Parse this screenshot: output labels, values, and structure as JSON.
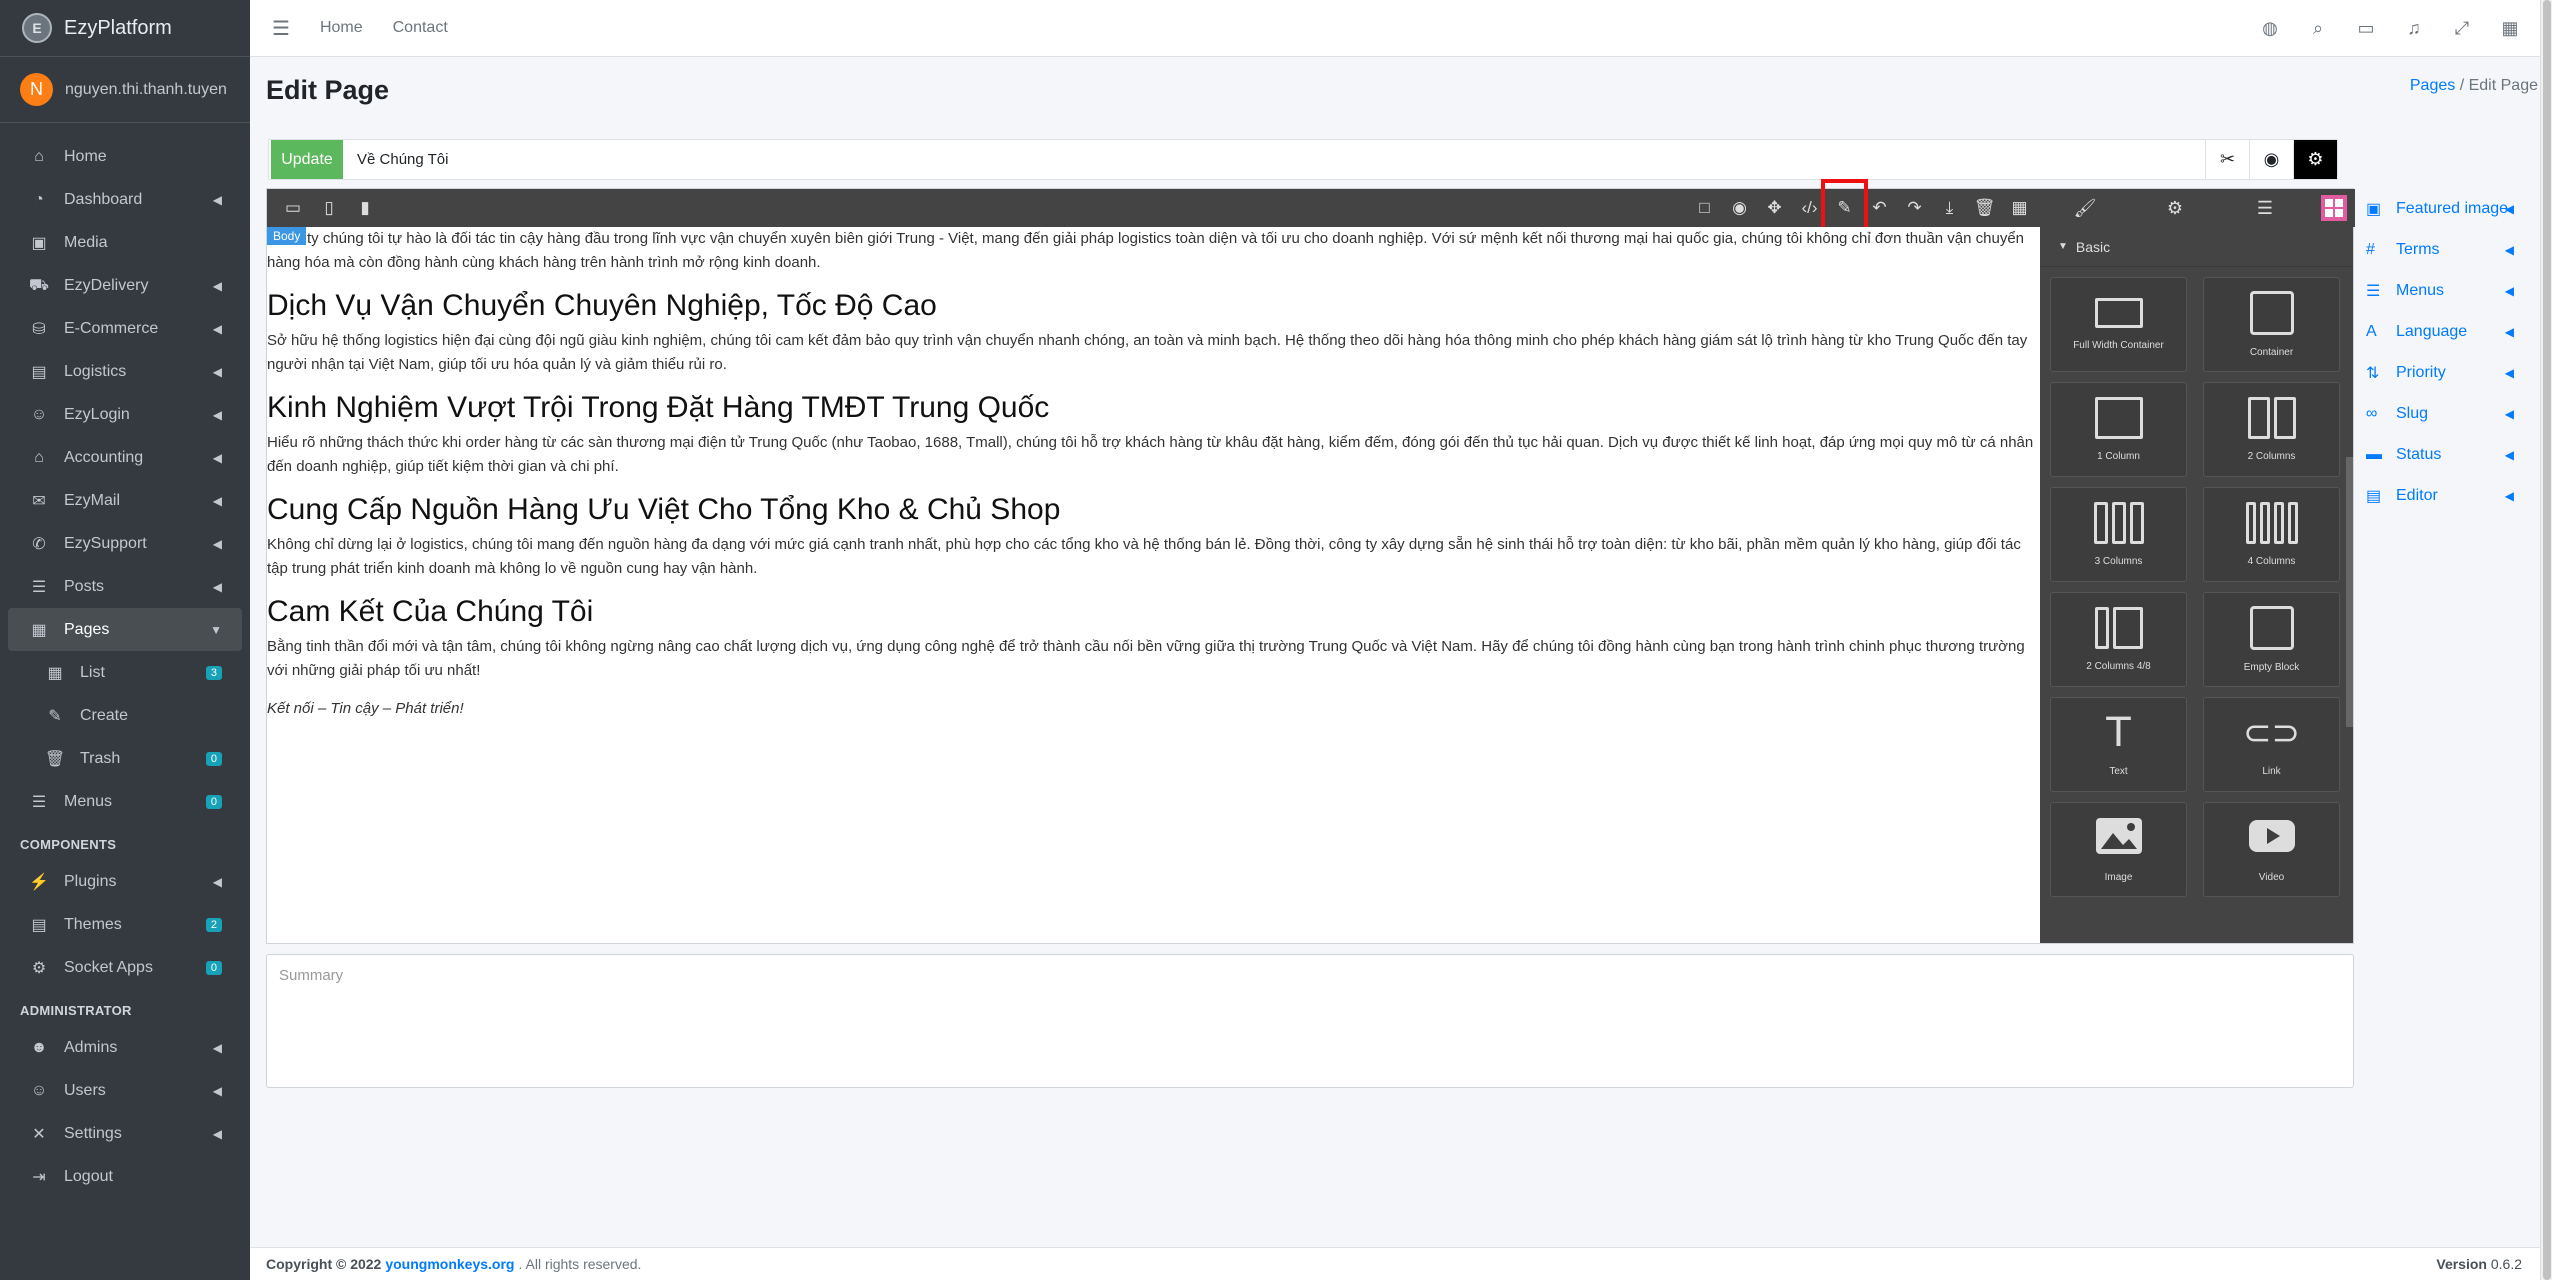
{
  "brand": {
    "logo_glyph": "E",
    "name": "EzyPlatform"
  },
  "user": {
    "initial": "N",
    "name": "nguyen.thi.thanh.tuyen",
    "avatar_color": "#fd7e14"
  },
  "sidebar": {
    "items": [
      {
        "label": "Home",
        "icon": "home-icon",
        "glyph": "⌂"
      },
      {
        "label": "Dashboard",
        "icon": "dashboard-icon",
        "glyph": "◔",
        "chevron": true
      },
      {
        "label": "Media",
        "icon": "media-icon",
        "glyph": "▣"
      },
      {
        "label": "EzyDelivery",
        "icon": "truck-icon",
        "glyph": "⛟",
        "chevron": true
      },
      {
        "label": "E-Commerce",
        "icon": "cart-icon",
        "glyph": "⛁",
        "chevron": true
      },
      {
        "label": "Logistics",
        "icon": "clipboard-icon",
        "glyph": "▤",
        "chevron": true
      },
      {
        "label": "EzyLogin",
        "icon": "user-icon",
        "glyph": "☺",
        "chevron": true
      },
      {
        "label": "Accounting",
        "icon": "bank-icon",
        "glyph": "⌂",
        "chevron": true
      },
      {
        "label": "EzyMail",
        "icon": "mail-icon",
        "glyph": "✉",
        "chevron": true
      },
      {
        "label": "EzySupport",
        "icon": "support-icon",
        "glyph": "✆",
        "chevron": true
      },
      {
        "label": "Posts",
        "icon": "posts-icon",
        "glyph": "☰",
        "chevron": true
      },
      {
        "label": "Pages",
        "icon": "pages-icon",
        "glyph": "▦",
        "chevron": true,
        "active": true
      },
      {
        "label": "List",
        "icon": "list-icon",
        "glyph": "▦",
        "badge": "3",
        "sub": true
      },
      {
        "label": "Create",
        "icon": "edit-icon",
        "glyph": "✎",
        "sub": true
      },
      {
        "label": "Trash",
        "icon": "trash-icon",
        "glyph": "🗑",
        "badge": "0",
        "sub": true
      },
      {
        "label": "Menus",
        "icon": "menu-icon",
        "glyph": "☰",
        "badge": "0"
      }
    ],
    "components_header": "COMPONENTS",
    "components": [
      {
        "label": "Plugins",
        "icon": "plug-icon",
        "glyph": "⚡",
        "chevron": true
      },
      {
        "label": "Themes",
        "icon": "themes-icon",
        "glyph": "▤",
        "badge": "2"
      },
      {
        "label": "Socket Apps",
        "icon": "socket-icon",
        "glyph": "⚙",
        "badge": "0"
      }
    ],
    "admin_header": "ADMINISTRATOR",
    "admin": [
      {
        "label": "Admins",
        "icon": "admin-icon",
        "glyph": "☻",
        "chevron": true
      },
      {
        "label": "Users",
        "icon": "users-icon",
        "glyph": "☺",
        "chevron": true
      },
      {
        "label": "Settings",
        "icon": "settings-icon",
        "glyph": "✕",
        "chevron": true
      },
      {
        "label": "Logout",
        "icon": "logout-icon",
        "glyph": "⇥"
      }
    ]
  },
  "topbar": {
    "home": "Home",
    "contact": "Contact"
  },
  "page": {
    "title": "Edit Page",
    "crumb_link": "Pages",
    "crumb_sep": "/",
    "crumb_current": "Edit Page"
  },
  "titlebar": {
    "update_label": "Update",
    "title_value": "Về Chúng Tôi"
  },
  "canvas": {
    "body_tag": "Body",
    "intro": "ty chúng tôi tự hào là đối tác tin cậy hàng đầu trong lĩnh vực vận chuyển xuyên biên giới Trung - Việt, mang đến giải pháp logistics toàn diện và tối ưu cho doanh nghiệp. Với sứ mệnh kết nối thương mại hai quốc gia, chúng tôi không chỉ đơn thuần vận chuyển hàng hóa mà còn đồng hành cùng khách hàng trên hành trình mở rộng kinh doanh.",
    "sections": [
      {
        "heading": "Dịch Vụ Vận Chuyển Chuyên Nghiệp, Tốc Độ Cao",
        "text": "Sở hữu hệ thống logistics hiện đại cùng đội ngũ giàu kinh nghiệm, chúng tôi cam kết đảm bảo quy trình vận chuyển nhanh chóng, an toàn và minh bạch. Hệ thống theo dõi hàng hóa thông minh cho phép khách hàng giám sát lộ trình hàng từ kho Trung Quốc đến tay người nhận tại Việt Nam, giúp tối ưu hóa quản lý và giảm thiểu rủi ro."
      },
      {
        "heading": "Kinh Nghiệm Vượt Trội Trong Đặt Hàng TMĐT Trung Quốc",
        "text": "Hiểu rõ những thách thức khi order hàng từ các sàn thương mại điện tử Trung Quốc (như Taobao, 1688, Tmall), chúng tôi hỗ trợ khách hàng từ khâu đặt hàng, kiểm đếm, đóng gói đến thủ tục hải quan. Dịch vụ được thiết kế linh hoạt, đáp ứng mọi quy mô từ cá nhân đến doanh nghiệp, giúp tiết kiệm thời gian và chi phí."
      },
      {
        "heading": "Cung Cấp Nguồn Hàng Ưu Việt Cho Tổng Kho & Chủ Shop",
        "text": "Không chỉ dừng lại ở logistics, chúng tôi mang đến nguồn hàng đa dạng với mức giá cạnh tranh nhất, phù hợp cho các tổng kho và hệ thống bán lẻ. Đồng thời, công ty xây dựng sẵn hệ sinh thái hỗ trợ toàn diện: từ kho bãi, phần mềm quản lý kho hàng, giúp đối tác tập trung phát triển kinh doanh mà không lo về nguồn cung hay vận hành."
      },
      {
        "heading": "Cam Kết Của Chúng Tôi",
        "text": "Bằng tinh thần đổi mới và tận tâm, chúng tôi không ngừng nâng cao chất lượng dịch vụ, ứng dụng công nghệ để trở thành cầu nối bền vững giữa thị trường Trung Quốc và Việt Nam. Hãy để chúng tôi đồng hành cùng bạn trong hành trình chinh phục thương trường với những giải pháp tối ưu nhất!"
      }
    ],
    "tagline": "Kết nối – Tin cậy – Phát triển!"
  },
  "blocks": {
    "category": "Basic",
    "items": [
      {
        "label": "Full Width Container",
        "shape": "rect"
      },
      {
        "label": "Container",
        "shape": "sq"
      },
      {
        "label": "1 Column",
        "shape": "c1"
      },
      {
        "label": "2 Columns",
        "shape": "c2"
      },
      {
        "label": "3 Columns",
        "shape": "c3"
      },
      {
        "label": "4 Columns",
        "shape": "c4"
      },
      {
        "label": "2 Columns 4/8",
        "shape": "c48"
      },
      {
        "label": "Empty Block",
        "shape": "sq"
      },
      {
        "label": "Text",
        "shape": "text"
      },
      {
        "label": "Link",
        "shape": "link"
      },
      {
        "label": "Image",
        "shape": "image"
      },
      {
        "label": "Video",
        "shape": "video"
      }
    ]
  },
  "meta": [
    {
      "label": "Featured image",
      "icon": "image-icon",
      "glyph": "▣"
    },
    {
      "label": "Terms",
      "icon": "hashtag-icon",
      "glyph": "#"
    },
    {
      "label": "Menus",
      "icon": "menu-icon",
      "glyph": "☰"
    },
    {
      "label": "Language",
      "icon": "language-icon",
      "glyph": "A"
    },
    {
      "label": "Priority",
      "icon": "sort-icon",
      "glyph": "⇅"
    },
    {
      "label": "Slug",
      "icon": "link-icon",
      "glyph": "∞"
    },
    {
      "label": "Status",
      "icon": "status-icon",
      "glyph": "▬"
    },
    {
      "label": "Editor",
      "icon": "editor-icon",
      "glyph": "▤"
    }
  ],
  "summary": {
    "placeholder": "Summary"
  },
  "footer": {
    "copyright": "Copyright © 2022",
    "link": "youngmonkeys.org",
    "rights": ". All rights reserved.",
    "version_label": "Version",
    "version": "0.6.2"
  }
}
